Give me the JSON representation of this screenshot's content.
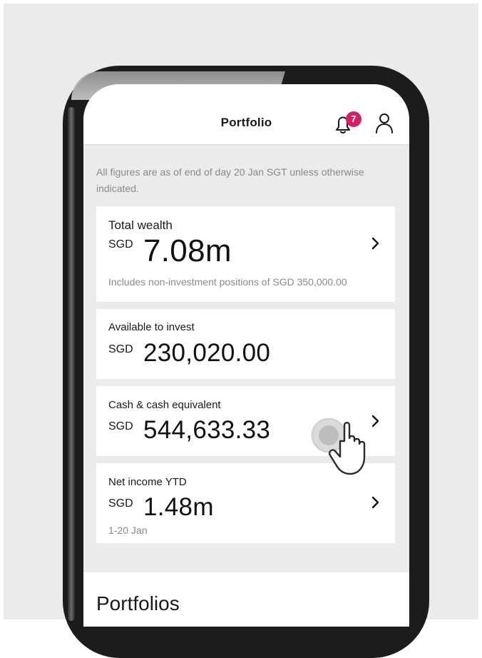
{
  "header": {
    "title": "Portfolio",
    "notification_count": "7",
    "notification_icon": "bell-icon",
    "profile_icon": "user-icon"
  },
  "note": "All figures are as of end of day 20 Jan SGT unless otherwise indicated.",
  "cards": {
    "total_wealth": {
      "label": "Total wealth",
      "currency": "SGD",
      "amount": "7.08m",
      "sub": "Includes non-investment positions of SGD 350,000.00"
    },
    "available": {
      "label": "Available to invest",
      "currency": "SGD",
      "amount": "230,020.00"
    },
    "cash": {
      "label": "Cash & cash equivalent",
      "currency": "SGD",
      "amount": "544,633.33"
    },
    "net_income": {
      "label": "Net income YTD",
      "currency": "SGD",
      "amount": "1.48m",
      "sub": "1-20 Jan"
    }
  },
  "portfolios": {
    "title": "Portfolios"
  },
  "colors": {
    "badge": "#d71e63",
    "background": "#ebebeb"
  }
}
